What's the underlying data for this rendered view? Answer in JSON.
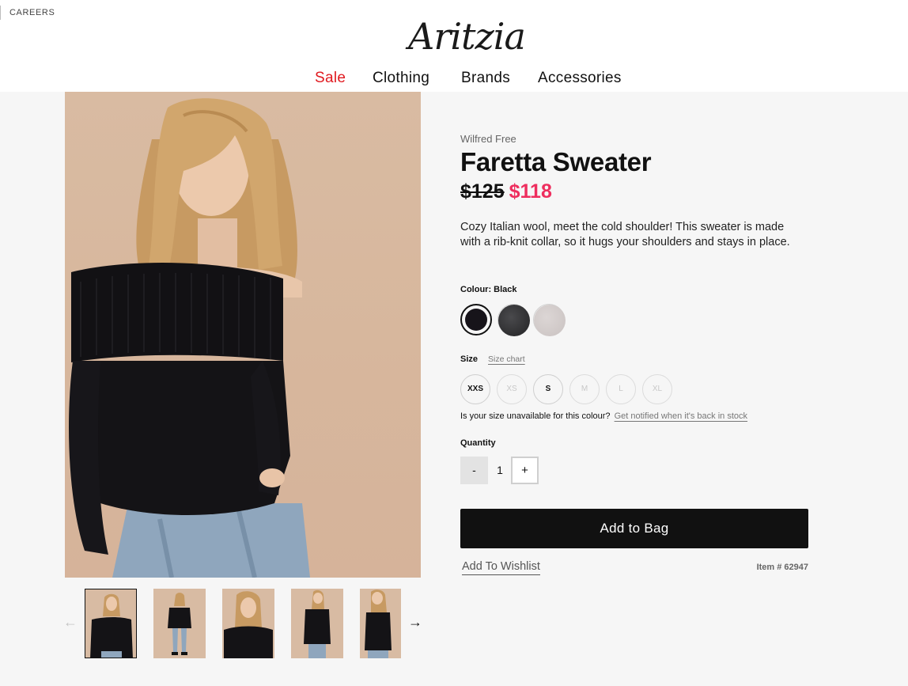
{
  "header": {
    "careers_label": "CAREERS",
    "logo_text": "Aritzia",
    "nav": [
      {
        "label": "Sale",
        "color": "#e0191f"
      },
      {
        "label": "Clothing"
      },
      {
        "label": "Brands"
      },
      {
        "label": "Accessories"
      }
    ]
  },
  "product": {
    "brand": "Wilfred Free",
    "name": "Faretta Sweater",
    "price_original": "$125",
    "price_sale": "$118",
    "description": "Cozy Italian wool, meet the cold shoulder! This sweater is made with a rib-knit collar, so it hugs your shoulders and stays in place.",
    "colour_label": "Colour:",
    "colour_selected": "Black",
    "colours": [
      {
        "name": "Black",
        "hex": "#17141a",
        "selected": true
      },
      {
        "name": "Charcoal",
        "hex": "#3a3a3c",
        "selected": false
      },
      {
        "name": "Heather Grey",
        "hex": "#d2cccb",
        "selected": false
      }
    ],
    "size_label": "Size",
    "size_chart_label": "Size chart",
    "sizes": [
      {
        "label": "XXS",
        "available": true
      },
      {
        "label": "XS",
        "available": false
      },
      {
        "label": "S",
        "available": true
      },
      {
        "label": "M",
        "available": false
      },
      {
        "label": "L",
        "available": false
      },
      {
        "label": "XL",
        "available": false
      }
    ],
    "unavailable_text": "Is your size unavailable for this colour?",
    "notify_link": "Get notified when it's back in stock",
    "quantity_label": "Quantity",
    "quantity_minus": "-",
    "quantity_value": "1",
    "quantity_plus": "+",
    "add_to_bag": "Add to Bag",
    "add_to_wishlist": "Add To Wishlist",
    "item_number": "Item # 62947"
  },
  "gallery": {
    "prev_arrow": "←",
    "next_arrow": "→",
    "thumbnails": [
      "front-view",
      "full-length-view",
      "close-up-view",
      "side-view",
      "back-view"
    ],
    "active_index": 0
  },
  "colors": {
    "sale_red": "#e0191f",
    "price_pink": "#ee2e5e",
    "button_black": "#111111",
    "backdrop_beige": "#d9bba2"
  }
}
